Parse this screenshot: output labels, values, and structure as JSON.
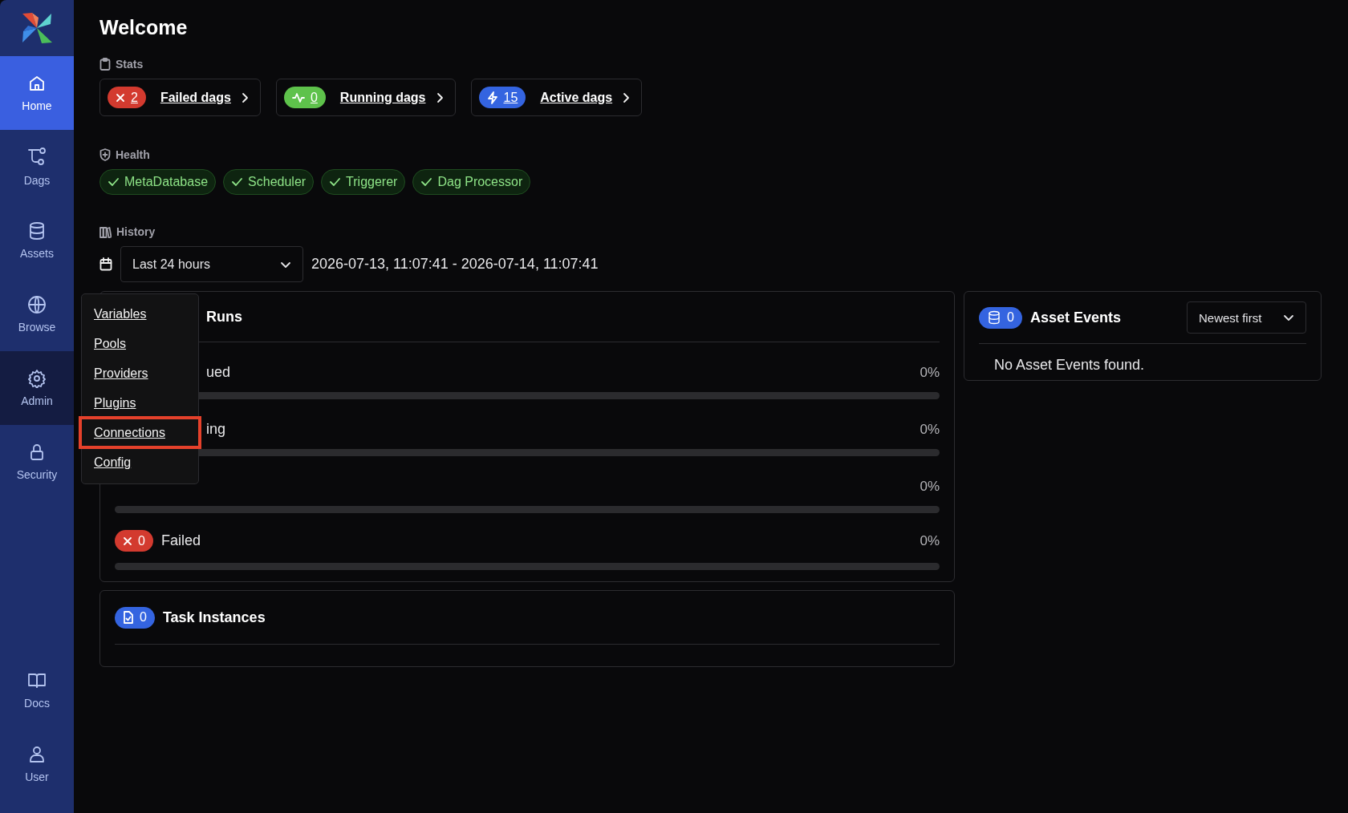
{
  "sidebar": {
    "items": [
      {
        "label": "Home",
        "selected": true,
        "expanded": false
      },
      {
        "label": "Dags",
        "selected": false,
        "expanded": false
      },
      {
        "label": "Assets",
        "selected": false,
        "expanded": false
      },
      {
        "label": "Browse",
        "selected": false,
        "expanded": false
      },
      {
        "label": "Admin",
        "selected": false,
        "expanded": true
      },
      {
        "label": "Security",
        "selected": false,
        "expanded": false
      }
    ],
    "bottom_items": [
      {
        "label": "Docs"
      },
      {
        "label": "User"
      }
    ]
  },
  "page": {
    "title": "Welcome"
  },
  "stats": {
    "label": "Stats",
    "cards": [
      {
        "kind": "failed",
        "count": "2",
        "label": "Failed dags",
        "color": "#d33a2f"
      },
      {
        "kind": "running",
        "count": "0",
        "label": "Running dags",
        "color": "#5ec24b"
      },
      {
        "kind": "active",
        "count": "15",
        "label": "Active dags",
        "color": "#3464e0"
      }
    ]
  },
  "health": {
    "label": "Health",
    "items": [
      {
        "label": "MetaDatabase",
        "healthy": true
      },
      {
        "label": "Scheduler",
        "healthy": true
      },
      {
        "label": "Triggerer",
        "healthy": true
      },
      {
        "label": "Dag Processor",
        "healthy": true
      }
    ]
  },
  "history": {
    "label": "History",
    "range": {
      "value": "Last 24 hours"
    },
    "date_range": "2026-07-13, 11:07:41 - 2026-07-14, 11:07:41"
  },
  "dag_runs": {
    "title": "Runs",
    "rows": [
      {
        "kind": "covered",
        "label": "ued",
        "percent": "0%",
        "level": 0
      },
      {
        "kind": "covered",
        "label": "ing",
        "percent": "0%",
        "level": 0
      },
      {
        "kind": "covered",
        "percent": "0%",
        "level": 0
      },
      {
        "kind": "failed",
        "count": "0",
        "label": "Failed",
        "percent": "0%",
        "level": 0,
        "color": "#d33a2f"
      }
    ]
  },
  "task_instances": {
    "count": "0",
    "title": "Task Instances"
  },
  "asset_events": {
    "count": "0",
    "title": "Asset Events",
    "sort": {
      "value": "Newest first"
    },
    "empty_message": "No Asset Events found."
  },
  "admin_menu": {
    "items": [
      {
        "label": "Variables",
        "highlighted": false
      },
      {
        "label": "Pools",
        "highlighted": false
      },
      {
        "label": "Providers",
        "highlighted": false
      },
      {
        "label": "Plugins",
        "highlighted": false
      },
      {
        "label": "Connections",
        "highlighted": true
      },
      {
        "label": "Config",
        "highlighted": false
      }
    ]
  }
}
